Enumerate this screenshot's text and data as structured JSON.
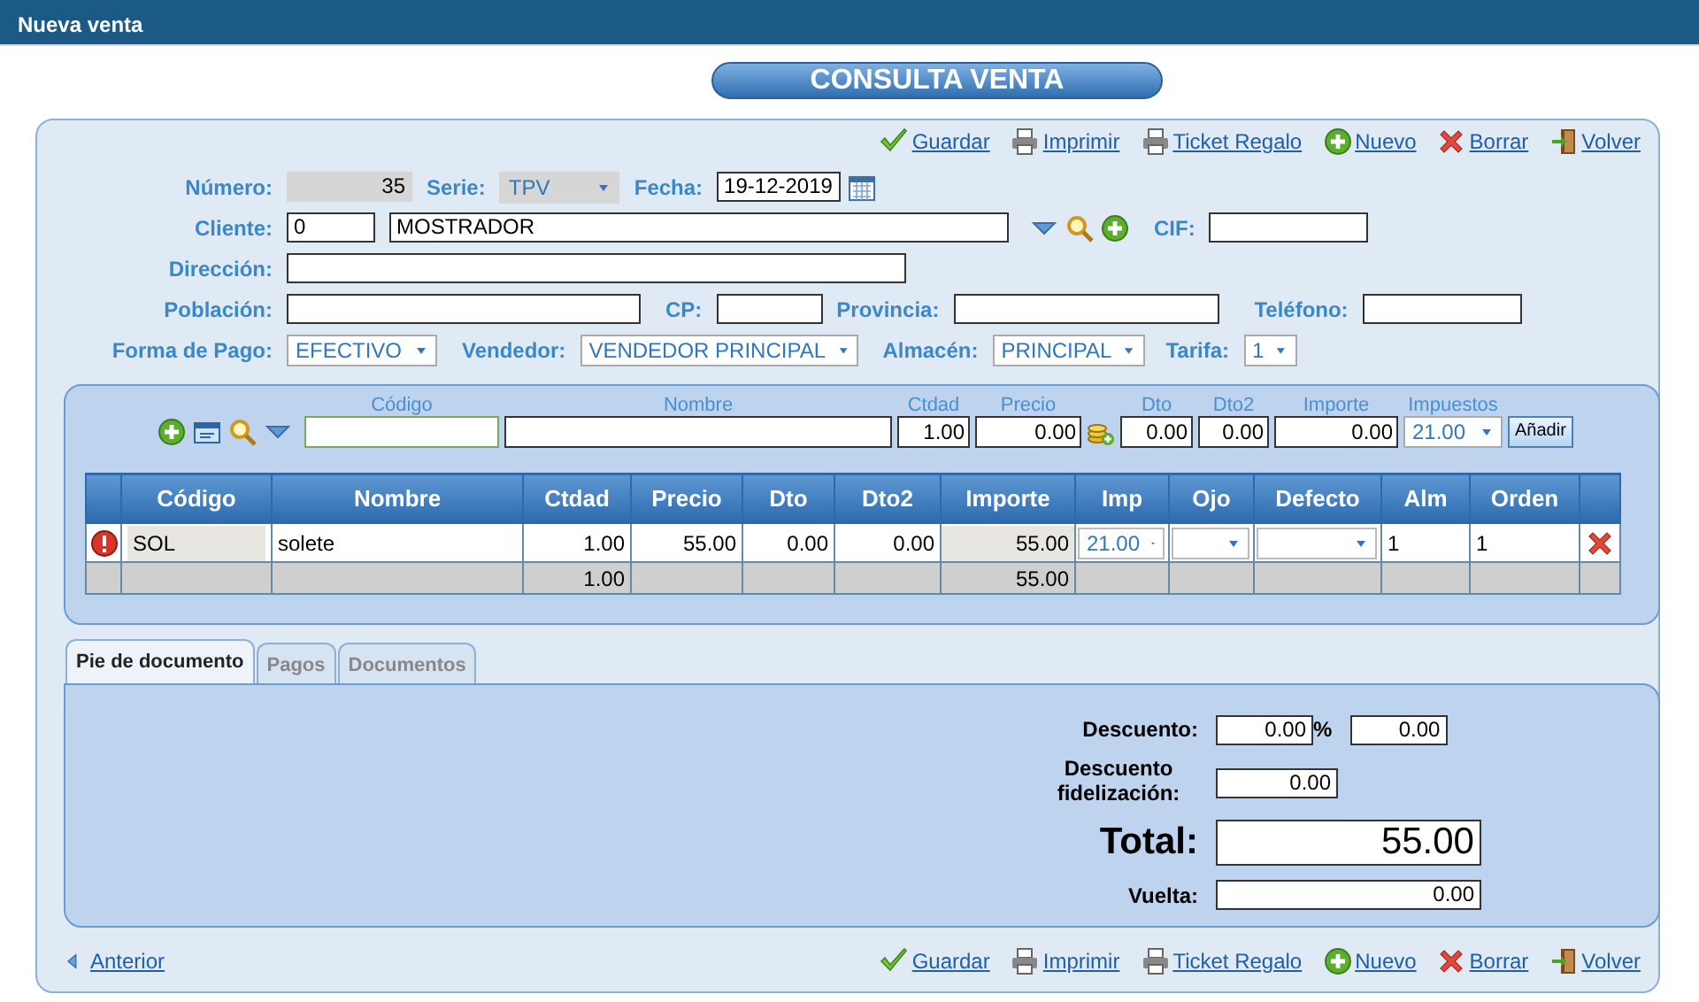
{
  "window": {
    "title": "Nueva venta"
  },
  "heading": "CONSULTA VENTA",
  "toolbar_top": [
    {
      "kind": "save",
      "label": "Guardar"
    },
    {
      "kind": "print",
      "label": "Imprimir"
    },
    {
      "kind": "print",
      "label": "Ticket Regalo"
    },
    {
      "kind": "new",
      "label": "Nuevo"
    },
    {
      "kind": "delete",
      "label": "Borrar"
    },
    {
      "kind": "back",
      "label": "Volver"
    }
  ],
  "header": {
    "numero": {
      "label": "Número:",
      "value": "35"
    },
    "serie": {
      "label": "Serie:",
      "value": "TPV",
      "disabled": true
    },
    "fecha": {
      "label": "Fecha:",
      "value": "19-12-2019"
    },
    "cliente": {
      "label": "Cliente:",
      "code": "0",
      "name": "MOSTRADOR"
    },
    "cif": {
      "label": "CIF:"
    },
    "direccion": {
      "label": "Dirección:"
    },
    "poblacion": {
      "label": "Población:"
    },
    "cp": {
      "label": "CP:"
    },
    "provincia": {
      "label": "Provincia:"
    },
    "telefono": {
      "label": "Teléfono:"
    },
    "forma_pago": {
      "label": "Forma de Pago:",
      "value": "EFECTIVO"
    },
    "vendedor": {
      "label": "Vendedor:",
      "value": "VENDEDOR PRINCIPAL"
    },
    "almacen": {
      "label": "Almacén:",
      "value": "PRINCIPAL"
    },
    "tarifa": {
      "label": "Tarifa:",
      "value": "1"
    }
  },
  "line_entry": {
    "fields": [
      {
        "label": "Código"
      },
      {
        "label": "Nombre"
      },
      {
        "label": "Ctdad",
        "value": "1.00"
      },
      {
        "label": "Precio",
        "value": "0.00"
      },
      {
        "label": "Dto",
        "value": "0.00"
      },
      {
        "label": "Dto2",
        "value": "0.00"
      },
      {
        "label": "Importe",
        "value": "0.00"
      },
      {
        "label": "Impuestos",
        "value": "21.00"
      }
    ],
    "add_button": "Añadir"
  },
  "table": {
    "columns": [
      "Código",
      "Nombre",
      "Ctdad",
      "Precio",
      "Dto",
      "Dto2",
      "Importe",
      "Imp",
      "Ojo",
      "Defecto",
      "Alm",
      "Orden"
    ],
    "rows": [
      {
        "warning": true,
        "codigo": "SOL",
        "nombre": "solete",
        "ctdad": "1.00",
        "precio": "55.00",
        "dto": "0.00",
        "dto2": "0.00",
        "importe": "55.00",
        "imp": "21.00",
        "alm": "1",
        "orden": "1"
      }
    ],
    "totals": {
      "ctdad": "1.00",
      "importe": "55.00"
    }
  },
  "tabs": [
    {
      "label": "Pie de documento",
      "selected": true
    },
    {
      "label": "Pagos",
      "selected": false
    },
    {
      "label": "Documentos",
      "selected": false
    }
  ],
  "summary": {
    "descuento": {
      "label": "Descuento:",
      "percent": "0.00",
      "percent_sign": "%",
      "amount": "0.00"
    },
    "descuento_fidelizacion": {
      "label": "Descuento fidelización:",
      "value": "0.00"
    },
    "total": {
      "label": "Total:",
      "value": "55.00"
    },
    "vuelta": {
      "label": "Vuelta:",
      "value": "0.00"
    }
  },
  "previous_link": "Anterior",
  "toolbar_bottom": [
    {
      "kind": "save",
      "label": "Guardar"
    },
    {
      "kind": "print",
      "label": "Imprimir"
    },
    {
      "kind": "print",
      "label": "Ticket Regalo"
    },
    {
      "kind": "new",
      "label": "Nuevo"
    },
    {
      "kind": "delete",
      "label": "Borrar"
    },
    {
      "kind": "back",
      "label": "Volver"
    }
  ]
}
